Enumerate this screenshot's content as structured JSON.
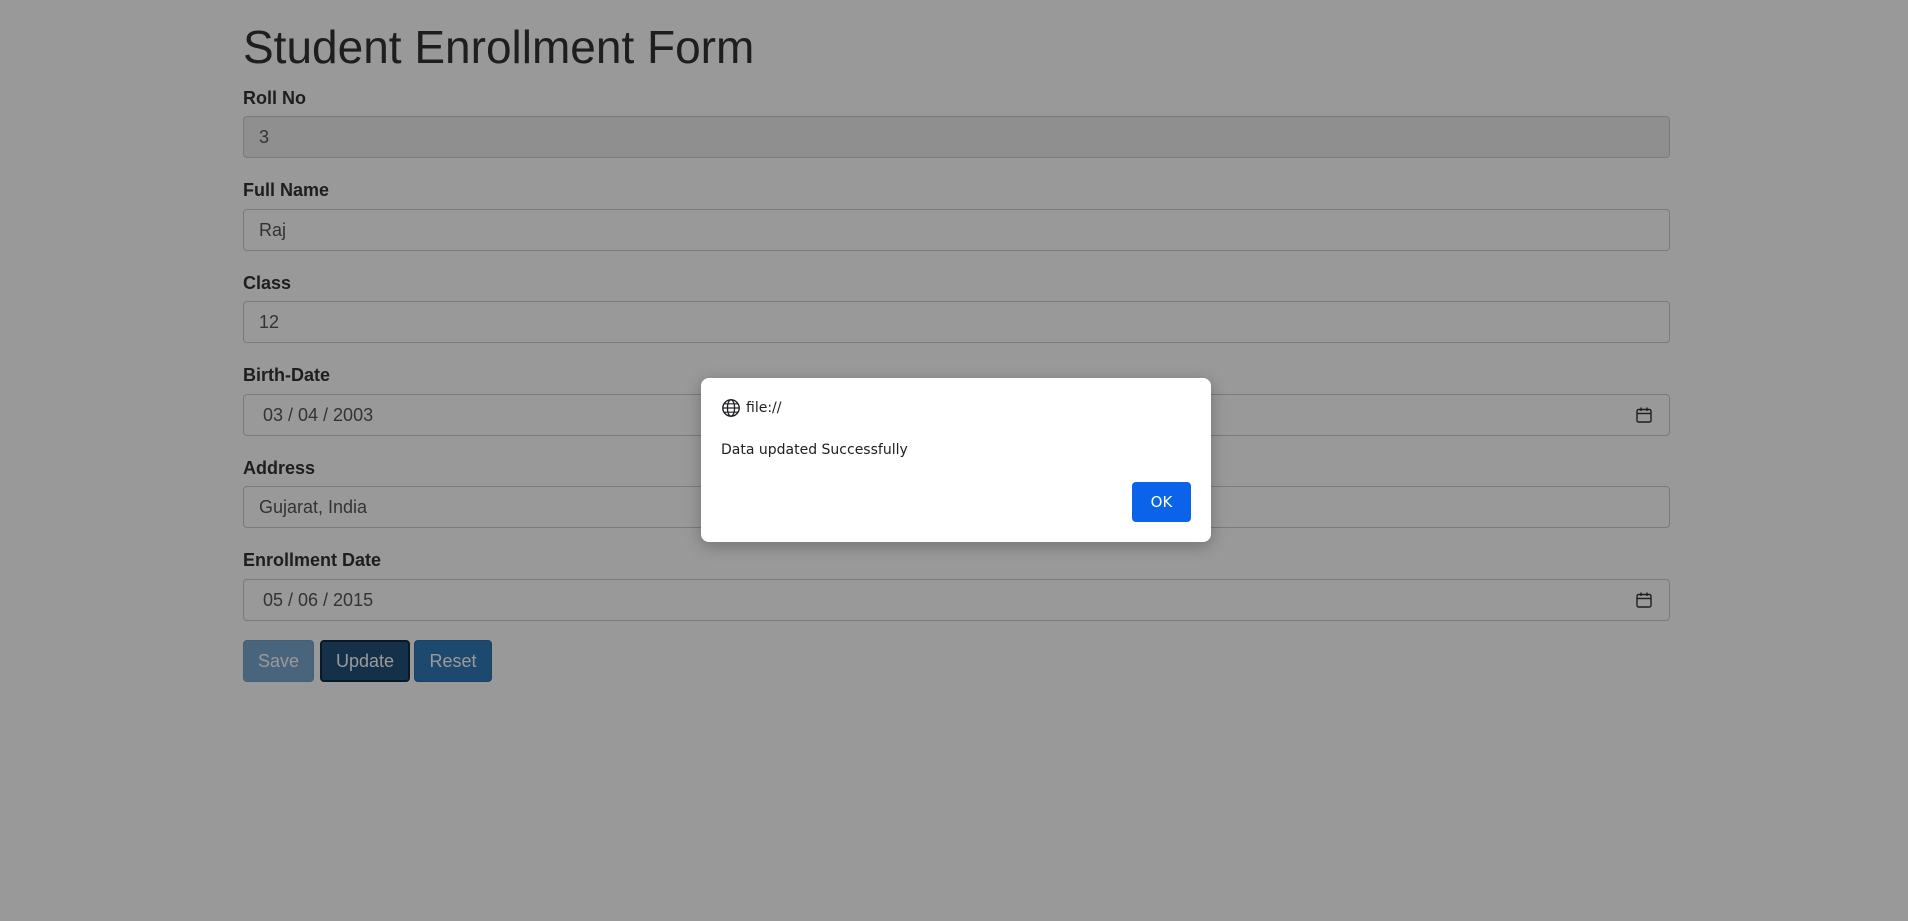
{
  "form": {
    "title": "Student Enrollment Form",
    "fields": {
      "roll_no": {
        "label": "Roll No",
        "value": "3"
      },
      "full_name": {
        "label": "Full Name",
        "value": "Raj"
      },
      "class": {
        "label": "Class",
        "value": "12"
      },
      "birth_date": {
        "label": "Birth-Date",
        "value": "03 / 04 / 2003"
      },
      "address": {
        "label": "Address",
        "value": "Gujarat, India"
      },
      "enrollment_date": {
        "label": "Enrollment Date",
        "value": "05 / 06 / 2015"
      }
    },
    "buttons": {
      "save": "Save",
      "update": "Update",
      "reset": "Reset"
    }
  },
  "alert": {
    "origin": "file://",
    "message": "Data updated Successfully",
    "ok_label": "OK"
  },
  "colors": {
    "primary_button": "#337ab7",
    "active_button": "#23527c",
    "dialog_ok": "#0a63e8"
  },
  "icons": {
    "date_picker": "calendar-icon",
    "dialog_origin": "globe-icon"
  }
}
